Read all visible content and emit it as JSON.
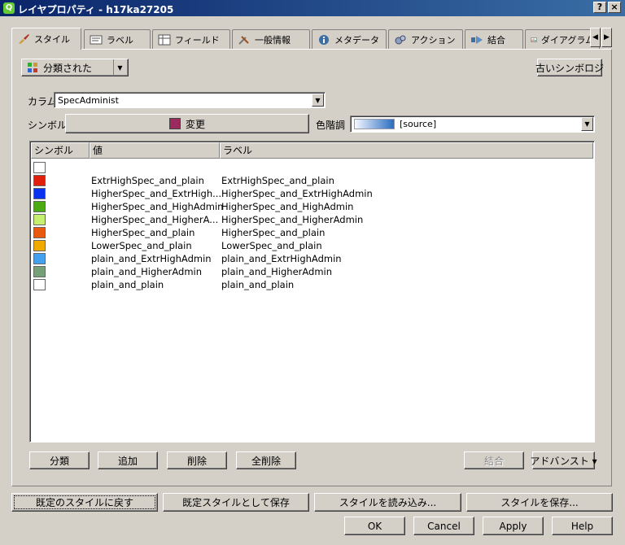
{
  "window": {
    "title": "レイヤプロパティ - h17ka27205",
    "help_glyph": "?",
    "close_glyph": "×",
    "app_glyph": "Q"
  },
  "tabs": [
    {
      "label": "スタイル",
      "icon": "brush-icon"
    },
    {
      "label": "ラベル",
      "icon": "label-icon"
    },
    {
      "label": "フィールド",
      "icon": "table-icon"
    },
    {
      "label": "一般情報",
      "icon": "tools-icon"
    },
    {
      "label": "メタデータ",
      "icon": "info-icon"
    },
    {
      "label": "アクション",
      "icon": "gears-icon"
    },
    {
      "label": "結合",
      "icon": "join-icon"
    },
    {
      "label": "ダイアグラム",
      "icon": "diagram-icon"
    }
  ],
  "tab_nav": {
    "left": "◀",
    "right": "▶"
  },
  "style": {
    "renderer_type": "分類された",
    "old_symbology_button": "古いシンボロジ",
    "column_label": "カラム",
    "column_value": "SpecAdminist",
    "symbol_label": "シンボル",
    "change_button": "変更",
    "change_swatch_color": "#9b2a5e",
    "color_ramp_label": "色階調",
    "color_ramp_value": "[source]",
    "combo_arrow": "▼"
  },
  "table": {
    "headers": [
      "シンボル",
      "値",
      "ラベル"
    ],
    "rows": [
      {
        "color": "#ffffff",
        "value": "",
        "label": ""
      },
      {
        "color": "#e0200c",
        "value": "ExtrHighSpec_and_plain",
        "label": "ExtrHighSpec_and_plain"
      },
      {
        "color": "#0a32f0",
        "value": "HigherSpec_and_ExtrHigh...",
        "label": "HigherSpec_and_ExtrHighAdmin"
      },
      {
        "color": "#4caa14",
        "value": "HigherSpec_and_HighAdmin",
        "label": "HigherSpec_and_HighAdmin"
      },
      {
        "color": "#c8f070",
        "value": "HigherSpec_and_HigherA...",
        "label": "HigherSpec_and_HigherAdmin"
      },
      {
        "color": "#ea5a0e",
        "value": "HigherSpec_and_plain",
        "label": "HigherSpec_and_plain"
      },
      {
        "color": "#f0aa00",
        "value": "LowerSpec_and_plain",
        "label": "LowerSpec_and_plain"
      },
      {
        "color": "#46a0f0",
        "value": "plain_and_ExtrHighAdmin",
        "label": "plain_and_ExtrHighAdmin"
      },
      {
        "color": "#78a078",
        "value": "plain_and_HigherAdmin",
        "label": "plain_and_HigherAdmin"
      },
      {
        "color": "#ffffff",
        "value": "plain_and_plain",
        "label": "plain_and_plain"
      }
    ]
  },
  "table_buttons": {
    "classify": "分類",
    "add": "追加",
    "delete": "削除",
    "delete_all": "全削除",
    "join": "結合",
    "advanced": "アドバンスト ▾"
  },
  "footer": {
    "restore_default": "既定のスタイルに戻す",
    "save_as_default": "既定スタイルとして保存",
    "load_style": "スタイルを読み込み...",
    "save_style": "スタイルを保存...",
    "ok": "OK",
    "cancel": "Cancel",
    "apply": "Apply",
    "help": "Help"
  }
}
